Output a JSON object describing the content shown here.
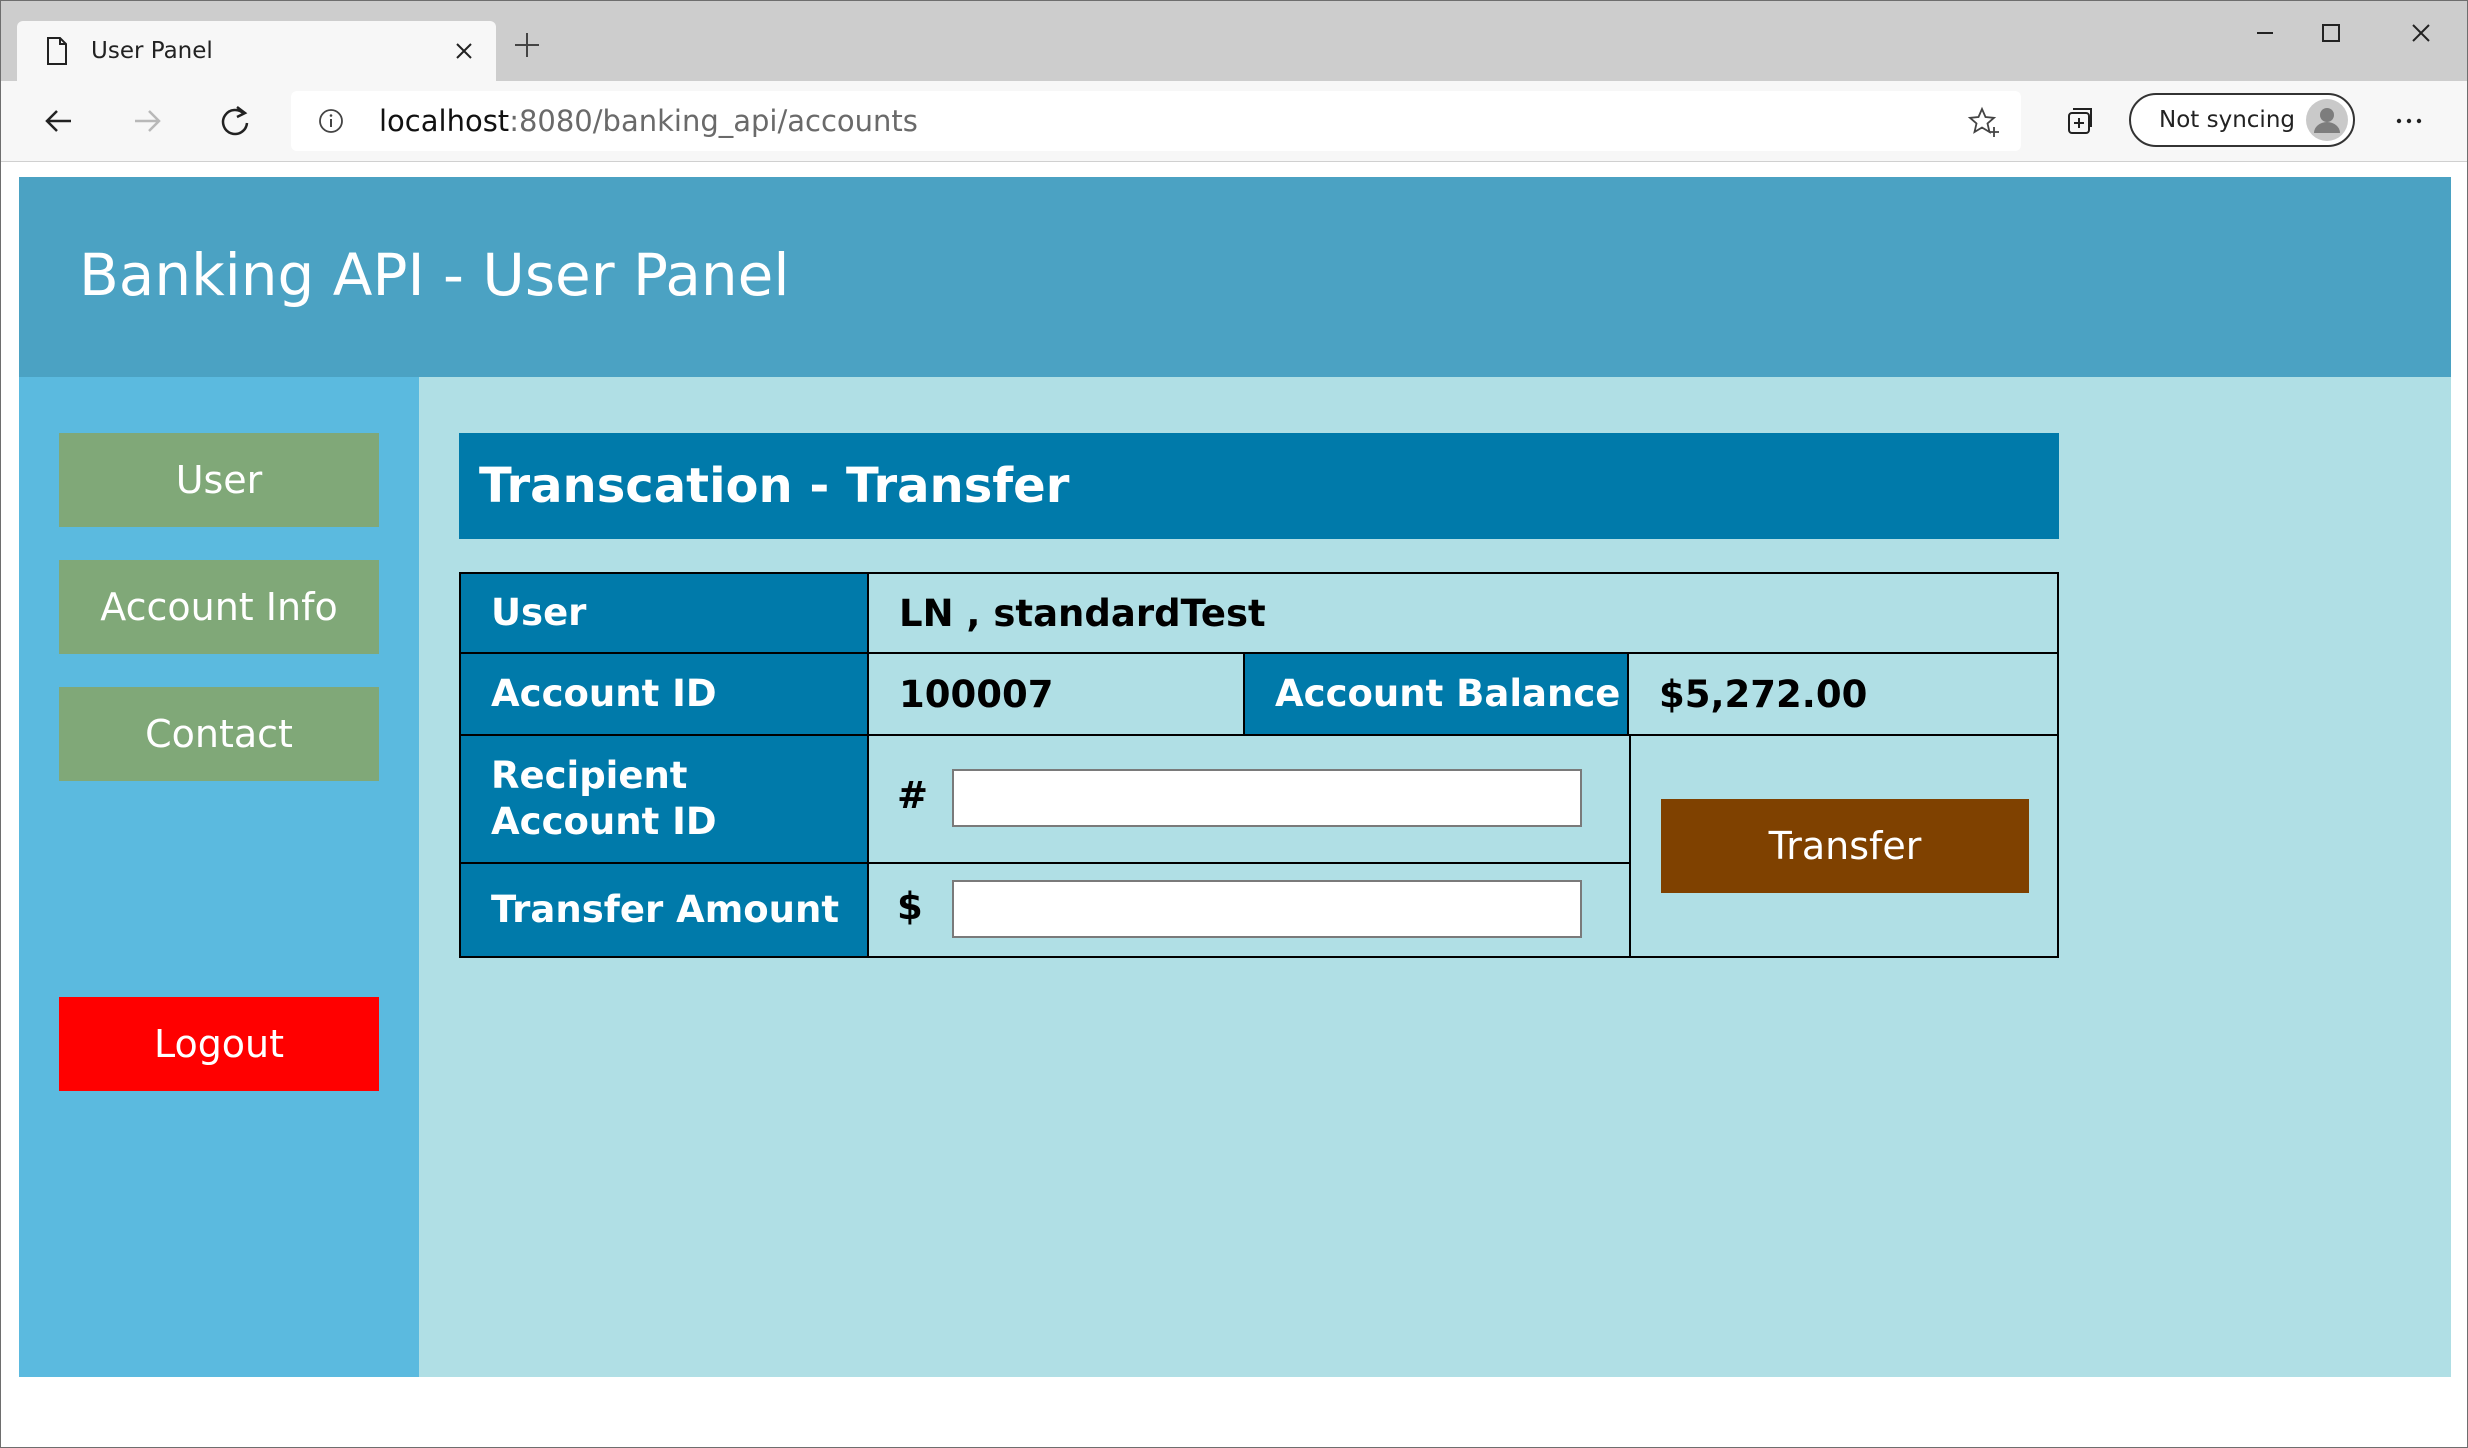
{
  "browser": {
    "tab_title": "User Panel",
    "url_host": "localhost",
    "url_rest": ":8080/banking_api/accounts",
    "sync_label": "Not syncing"
  },
  "header": {
    "title": "Banking API - User Panel"
  },
  "sidebar": {
    "items": [
      {
        "label": "User"
      },
      {
        "label": "Account Info"
      },
      {
        "label": "Contact"
      }
    ],
    "logout_label": "Logout"
  },
  "transfer": {
    "title": "Transcation - Transfer",
    "user_label": "User",
    "user_value": "LN , standardTest",
    "account_id_label": "Account ID",
    "account_id_value": "100007",
    "balance_label": "Account Balance",
    "balance_value": "$5,272.00",
    "recipient_label": "Recipient Account ID",
    "recipient_prefix": "#",
    "recipient_value": "",
    "amount_label": "Transfer Amount",
    "amount_prefix": "$",
    "amount_value": "",
    "button_label": "Transfer"
  },
  "colors": {
    "header": "#4ba2c3",
    "sidebar": "#5bbadf",
    "main": "#b0dfe5",
    "table_label": "#007aaa",
    "nav_button": "#80a878",
    "logout_button": "#ff0000",
    "transfer_button": "#7f4100"
  }
}
